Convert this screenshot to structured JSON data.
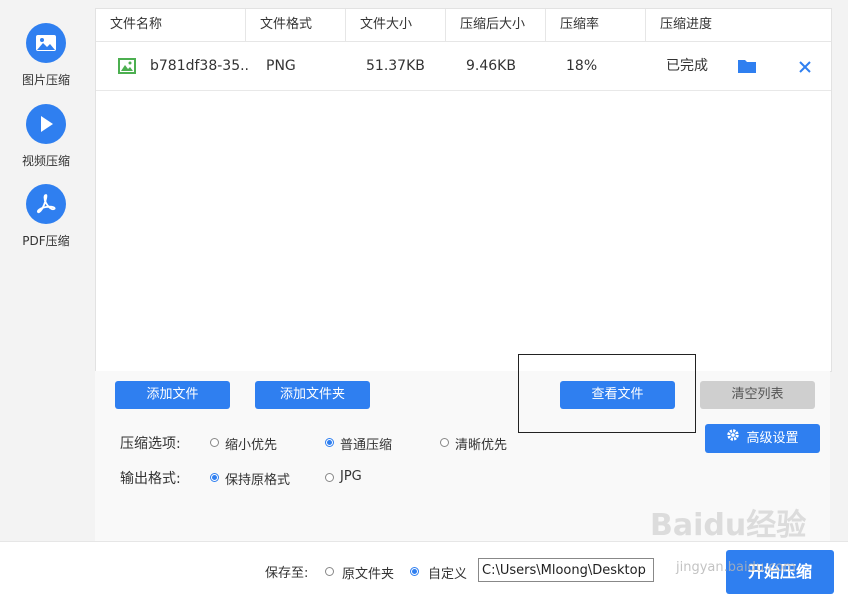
{
  "sidebar": {
    "items": [
      {
        "label": "图片压缩",
        "icon": "image-icon"
      },
      {
        "label": "视频压缩",
        "icon": "play-icon"
      },
      {
        "label": "PDF压缩",
        "icon": "pdf-icon"
      }
    ]
  },
  "table": {
    "columns": [
      "文件名称",
      "文件格式",
      "文件大小",
      "压缩后大小",
      "压缩率",
      "压缩进度"
    ],
    "rows": [
      {
        "name": "b781df38-35...",
        "format": "PNG",
        "size": "51.37KB",
        "compressed": "9.46KB",
        "ratio": "18%",
        "status": "已完成"
      }
    ]
  },
  "buttons": {
    "add_file": "添加文件",
    "add_folder": "添加文件夹",
    "view_file": "查看文件",
    "clear_list": "清空列表",
    "advanced": "高级设置",
    "start": "开始压缩"
  },
  "compression": {
    "label": "压缩选项:",
    "options": [
      "缩小优先",
      "普通压缩",
      "清晰优先"
    ],
    "selected": "普通压缩"
  },
  "output_format": {
    "label": "输出格式:",
    "options": [
      "保持原格式",
      "JPG"
    ],
    "selected": "保持原格式"
  },
  "save": {
    "label": "保存至:",
    "options": [
      "原文件夹",
      "自定义"
    ],
    "selected": "自定义",
    "path": "C:\\Users\\Mloong\\Desktop"
  },
  "watermark": {
    "text": "Baidu经验",
    "sub": "jingyan.baidu.com"
  },
  "colors": {
    "accent": "#2f7ff0",
    "icon_green": "#4caf50"
  }
}
